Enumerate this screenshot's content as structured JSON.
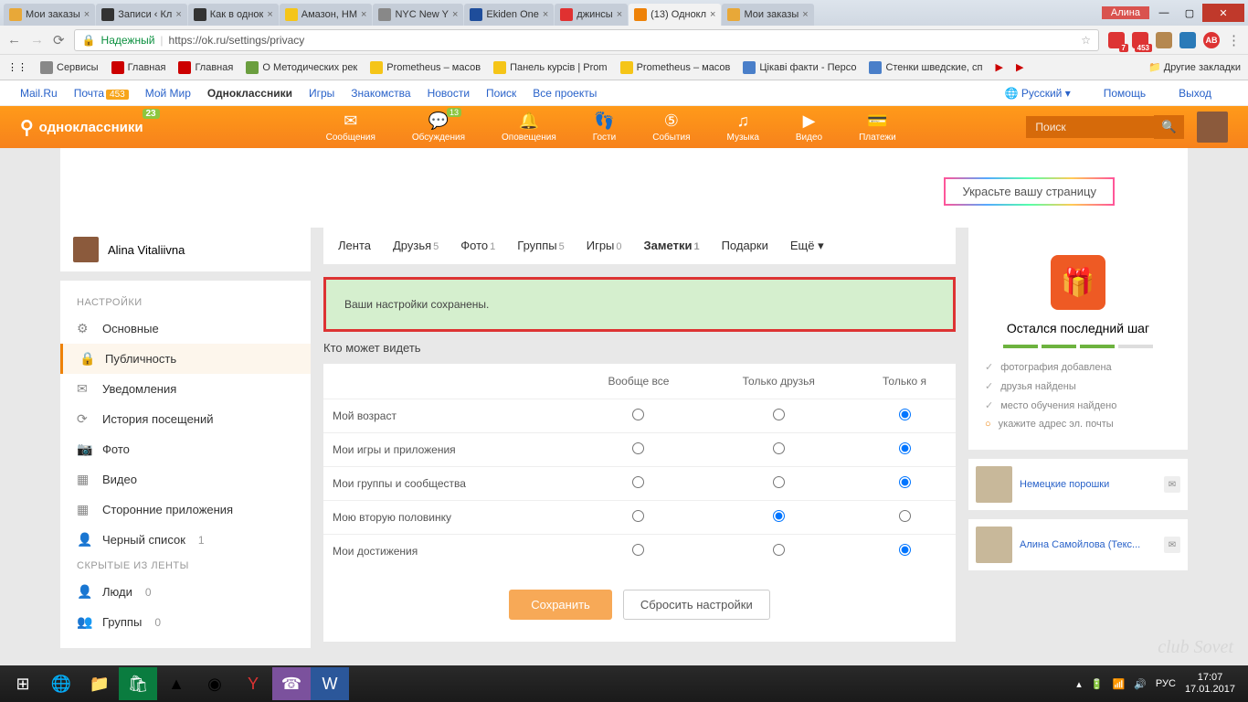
{
  "window": {
    "user": "Алина",
    "tabs": [
      {
        "title": "Мои заказы",
        "fav": "#e8a838"
      },
      {
        "title": "Записи ‹ Кл",
        "fav": "#333"
      },
      {
        "title": "Как в однок",
        "fav": "#333"
      },
      {
        "title": "Амазон, НМ",
        "fav": "#f5c518"
      },
      {
        "title": "NYC New Y",
        "fav": "#888"
      },
      {
        "title": "Ekiden One",
        "fav": "#1e4d9b"
      },
      {
        "title": "джинсы",
        "fav": "#e03131"
      },
      {
        "title": "(13) Однокл",
        "fav": "#ee8208",
        "active": true
      },
      {
        "title": "Мои заказы",
        "fav": "#e8a838"
      }
    ],
    "secure_label": "Надежный",
    "url": "https://ok.ru/settings/privacy",
    "ext_badges": {
      "red1": "7",
      "red2": "453"
    }
  },
  "bookmarks": [
    {
      "label": "Сервисы",
      "color": "#888"
    },
    {
      "label": "Главная",
      "color": "#cc0000"
    },
    {
      "label": "Главная",
      "color": "#cc0000"
    },
    {
      "label": "О Методических рек",
      "color": "#6b9e3f"
    },
    {
      "label": "Prometheus – масов",
      "color": "#f5c518"
    },
    {
      "label": "Панель курсів | Prom",
      "color": "#f5c518"
    },
    {
      "label": "Prometheus – масов",
      "color": "#f5c518"
    },
    {
      "label": "Цікаві факти - Персо",
      "color": "#4a7fc9"
    },
    {
      "label": "Стенки шведские, сп",
      "color": "#4a7fc9"
    }
  ],
  "bookmarks_more": "Другие закладки",
  "mailru": {
    "links": [
      "Mail.Ru",
      "Почта",
      "Мой Мир",
      "Одноклассники",
      "Игры",
      "Знакомства",
      "Новости",
      "Поиск",
      "Все проекты"
    ],
    "mail_badge": "453",
    "lang": "Русский",
    "help": "Помощь",
    "exit": "Выход"
  },
  "ok": {
    "brand": "одноклассники",
    "brand_badge": "23",
    "nav": [
      {
        "label": "Сообщения",
        "ic": "✉"
      },
      {
        "label": "Обсуждения",
        "ic": "💬",
        "badge": "13"
      },
      {
        "label": "Оповещения",
        "ic": "🔔"
      },
      {
        "label": "Гости",
        "ic": "👣"
      },
      {
        "label": "События",
        "ic": "⑤"
      },
      {
        "label": "Музыка",
        "ic": "♫"
      },
      {
        "label": "Видео",
        "ic": "▶"
      },
      {
        "label": "Платежи",
        "ic": "💳"
      }
    ],
    "search_ph": "Поиск"
  },
  "decorate": "Украсьте вашу страницу",
  "profile_name": "Alina Vitaliivna",
  "page_tabs": [
    {
      "label": "Лента"
    },
    {
      "label": "Друзья",
      "count": "5"
    },
    {
      "label": "Фото",
      "count": "1"
    },
    {
      "label": "Группы",
      "count": "5"
    },
    {
      "label": "Игры",
      "count": "0"
    },
    {
      "label": "Заметки",
      "count": "1",
      "active": true
    },
    {
      "label": "Подарки"
    },
    {
      "label": "Ещё ▾"
    }
  ],
  "sidebar": {
    "header1": "НАСТРОЙКИ",
    "items": [
      {
        "label": "Основные",
        "ic": "⚙"
      },
      {
        "label": "Публичность",
        "ic": "🔒",
        "active": true
      },
      {
        "label": "Уведомления",
        "ic": "✉"
      },
      {
        "label": "История посещений",
        "ic": "⟳"
      },
      {
        "label": "Фото",
        "ic": "📷"
      },
      {
        "label": "Видео",
        "ic": "▦"
      },
      {
        "label": "Сторонние приложения",
        "ic": "▦"
      },
      {
        "label": "Черный список",
        "ic": "👤",
        "count": "1"
      }
    ],
    "header2": "СКРЫТЫЕ ИЗ ЛЕНТЫ",
    "items2": [
      {
        "label": "Люди",
        "ic": "👤",
        "count": "0"
      },
      {
        "label": "Группы",
        "ic": "👥",
        "count": "0"
      }
    ]
  },
  "success_msg": "Ваши настройки сохранены.",
  "section_title": "Кто может видеть",
  "table": {
    "cols": [
      "",
      "Вообще все",
      "Только друзья",
      "Только я"
    ],
    "rows": [
      {
        "label": "Мой возраст",
        "sel": 2
      },
      {
        "label": "Мои игры и приложения",
        "sel": 2
      },
      {
        "label": "Мои группы и сообщества",
        "sel": 2
      },
      {
        "label": "Мою вторую половинку",
        "sel": 1
      },
      {
        "label": "Мои достижения",
        "sel": 2
      }
    ]
  },
  "buttons": {
    "save": "Сохранить",
    "reset": "Сбросить настройки"
  },
  "right": {
    "gift_title": "Остался последний шаг",
    "checks": [
      {
        "label": "фотография добавлена",
        "done": true
      },
      {
        "label": "друзья найдены",
        "done": true
      },
      {
        "label": "место обучения найдено",
        "done": true
      },
      {
        "label": "укажите адрес эл. почты",
        "done": false
      }
    ],
    "ads": [
      {
        "title": "Немецкие порошки"
      },
      {
        "title": "Алина Самойлова (Текс..."
      }
    ]
  },
  "taskbar": {
    "lang": "РУС",
    "time": "17:07",
    "date": "17.01.2017"
  },
  "watermark": "club Sovet"
}
